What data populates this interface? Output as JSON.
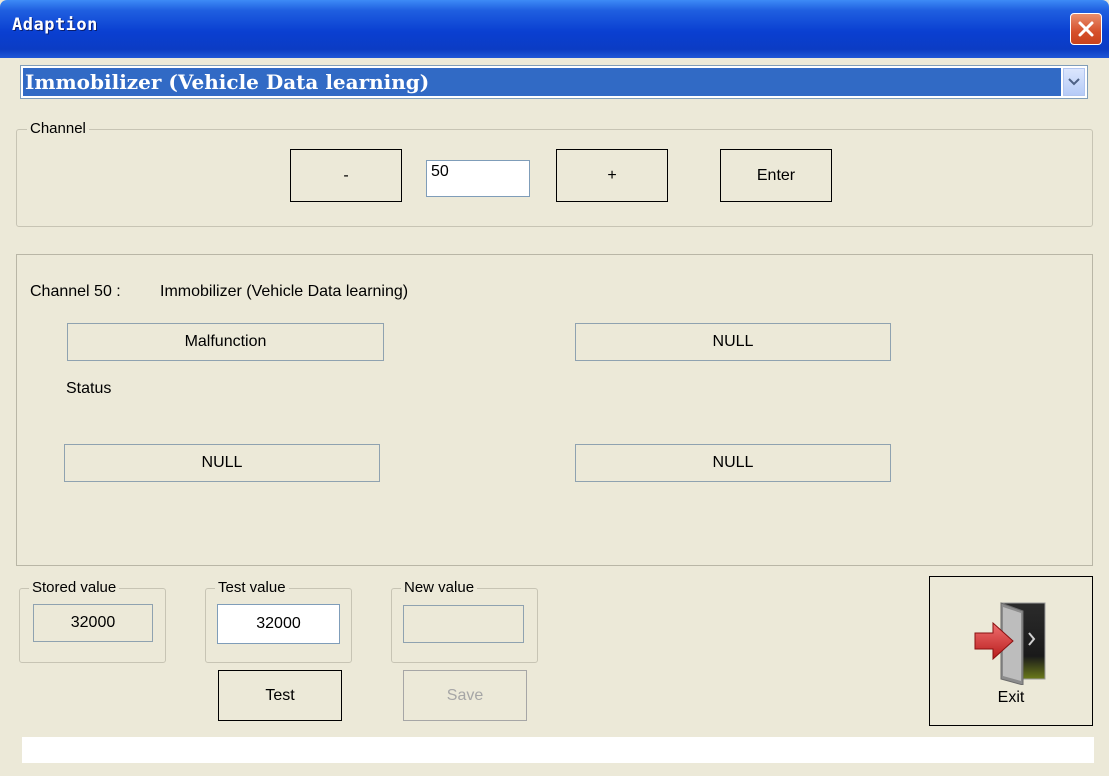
{
  "window": {
    "title": "Adaption"
  },
  "combo": {
    "selected": "Immobilizer (Vehicle Data learning)"
  },
  "channel": {
    "group_label": "Channel",
    "minus_label": "-",
    "value": "50",
    "plus_label": "+",
    "enter_label": "Enter"
  },
  "details": {
    "channel_label": "Channel 50 :",
    "channel_name": "Immobilizer (Vehicle Data learning)",
    "box1": "Malfunction",
    "box2": "NULL",
    "status_label": "Status",
    "box3": "NULL",
    "box4": "NULL"
  },
  "values": {
    "stored_label": "Stored value",
    "stored": "32000",
    "test_label": "Test value",
    "test": "32000",
    "new_label": "New value",
    "new": ""
  },
  "actions": {
    "test_label": "Test",
    "save_label": "Save",
    "exit_label": "Exit"
  },
  "status": {
    "text": ""
  },
  "colors": {
    "title_bar": "#0a3fd1",
    "selection": "#316ac5",
    "background": "#ece9d8",
    "close": "#d6502b"
  }
}
